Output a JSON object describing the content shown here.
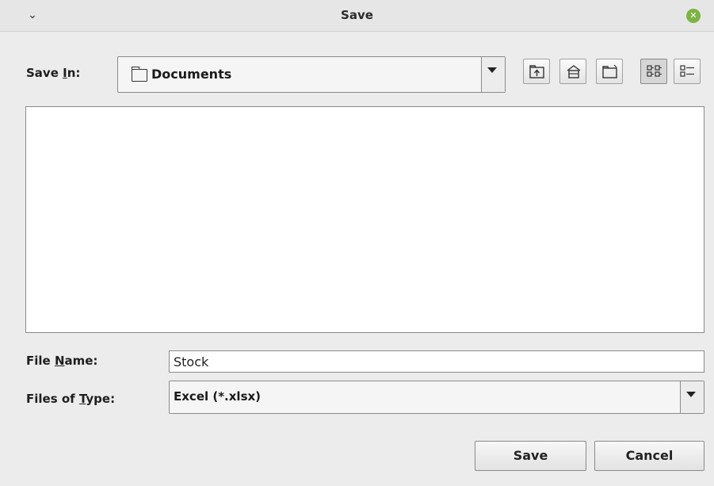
{
  "window": {
    "title": "Save"
  },
  "save_in": {
    "label_pre": "Save ",
    "label_mnemonic": "I",
    "label_post": "n:",
    "current_folder": "Documents"
  },
  "toolbar": {
    "buttons": [
      {
        "name": "up-one-level",
        "icon": "folder-up-icon"
      },
      {
        "name": "home",
        "icon": "home-icon"
      },
      {
        "name": "create-new-folder",
        "icon": "new-folder-icon"
      },
      {
        "name": "list-view",
        "icon": "list-view-icon",
        "pressed": true
      },
      {
        "name": "details-view",
        "icon": "details-view-icon",
        "pressed": false
      }
    ]
  },
  "file_name": {
    "label_pre": "File ",
    "label_mnemonic": "N",
    "label_post": "ame:",
    "value": "Stock"
  },
  "files_of_type": {
    "label_pre": "Files of ",
    "label_mnemonic": "T",
    "label_post": "ype:",
    "selected": "Excel (*.xlsx)"
  },
  "actions": {
    "save_label": "Save",
    "cancel_label": "Cancel"
  }
}
